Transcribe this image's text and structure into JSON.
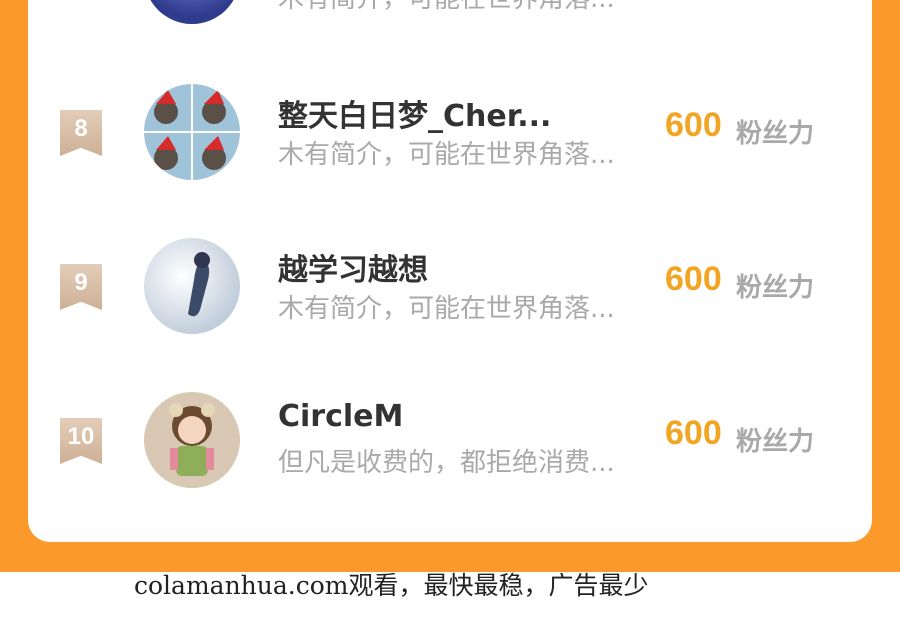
{
  "entries": [
    {
      "desc": "木有简介，可能在世界角落..."
    },
    {
      "rank": "8",
      "name": "整天白日梦_Cher...",
      "desc": "木有简介，可能在世界角落...",
      "score": "600",
      "unit": "粉丝力"
    },
    {
      "rank": "9",
      "name": "越学习越想",
      "desc": "木有简介，可能在世界角落...",
      "score": "600",
      "unit": "粉丝力"
    },
    {
      "rank": "10",
      "name": "CircleM",
      "desc": "但凡是收费的，都拒绝消费...",
      "score": "600",
      "unit": "粉丝力"
    }
  ],
  "footer": "colamanhua.com观看，最快最稳，广告最少",
  "colors": {
    "accent": "#fb9a2b",
    "score": "#f1a522",
    "rank_badge": "#d6b99e"
  }
}
